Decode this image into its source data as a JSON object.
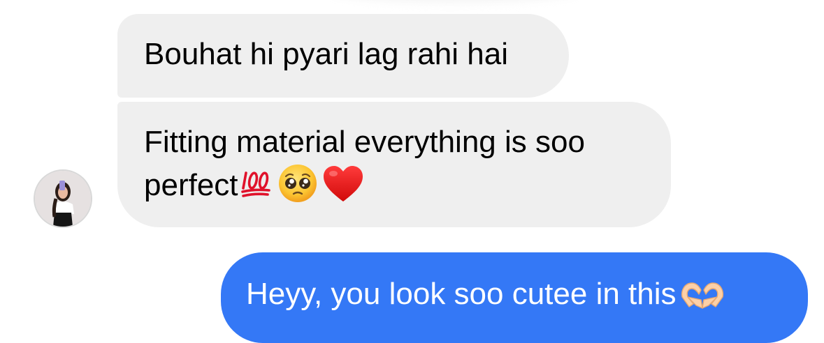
{
  "chat": {
    "messages": [
      {
        "direction": "incoming",
        "lines": [
          "Bouhat hi pyari lag rahi hai"
        ]
      },
      {
        "direction": "incoming",
        "lines": [
          "Fitting material everything is soo",
          "perfect"
        ],
        "emojis": [
          "hundred-points-icon",
          "pleading-face-icon",
          "red-heart-icon"
        ]
      },
      {
        "direction": "outgoing",
        "lines": [
          "Heyy, you look soo cutee in this"
        ],
        "emojis": [
          "heart-hands-icon"
        ]
      }
    ],
    "colors": {
      "incoming_bubble": "#efefef",
      "outgoing_bubble": "#3478f6",
      "incoming_text": "#000000",
      "outgoing_text": "#ffffff"
    }
  }
}
